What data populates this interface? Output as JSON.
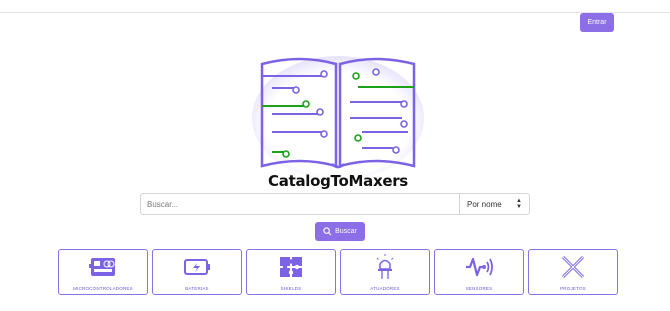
{
  "header": {
    "login_label": "Entrar"
  },
  "brand": {
    "name": "CatalogToMaxers"
  },
  "search": {
    "placeholder": "Buscar...",
    "sort_value": "Por nome",
    "submit_label": "Buscar"
  },
  "categories": [
    {
      "label": "Microcontroladores",
      "icon": "microcontroller-icon"
    },
    {
      "label": "Baterias",
      "icon": "battery-icon"
    },
    {
      "label": "Shields",
      "icon": "puzzle-icon"
    },
    {
      "label": "Atuadores",
      "icon": "led-icon"
    },
    {
      "label": "Sensores",
      "icon": "sensor-wave-icon"
    },
    {
      "label": "Projetos",
      "icon": "tools-icon"
    }
  ],
  "colors": {
    "accent": "#8c6ee6",
    "circuit_green": "#1aa31a"
  }
}
